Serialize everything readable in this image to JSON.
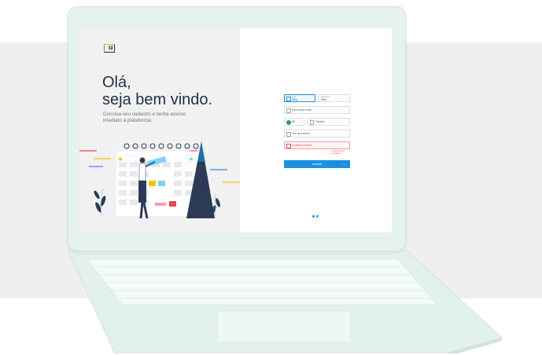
{
  "left": {
    "greeting_line1": "Olá,",
    "greeting_line2": "seja bem vindo.",
    "subtitle": "Conclua seu cadastro e tenha acesso imediato à plataforma."
  },
  "form": {
    "field_type_label": "Tipo",
    "field_type_value": "Filial",
    "field_name_label": "Empresa",
    "field_name_value": "Filial",
    "field_email_placeholder": "Seu melhor email",
    "phone_country": "BR",
    "phone_placeholder": "Telefone",
    "password_placeholder": "Crie uma senha",
    "confirm_placeholder": "Confirme a senha",
    "error_message": "As senhas não coincidem",
    "submit_label": "Avançar"
  },
  "colors": {
    "accent": "#1d8fe1",
    "error": "#e5484d",
    "heading": "#1f3048",
    "laptop": "#e6f2f0"
  },
  "pager": {
    "pages": 2,
    "active": 1
  }
}
